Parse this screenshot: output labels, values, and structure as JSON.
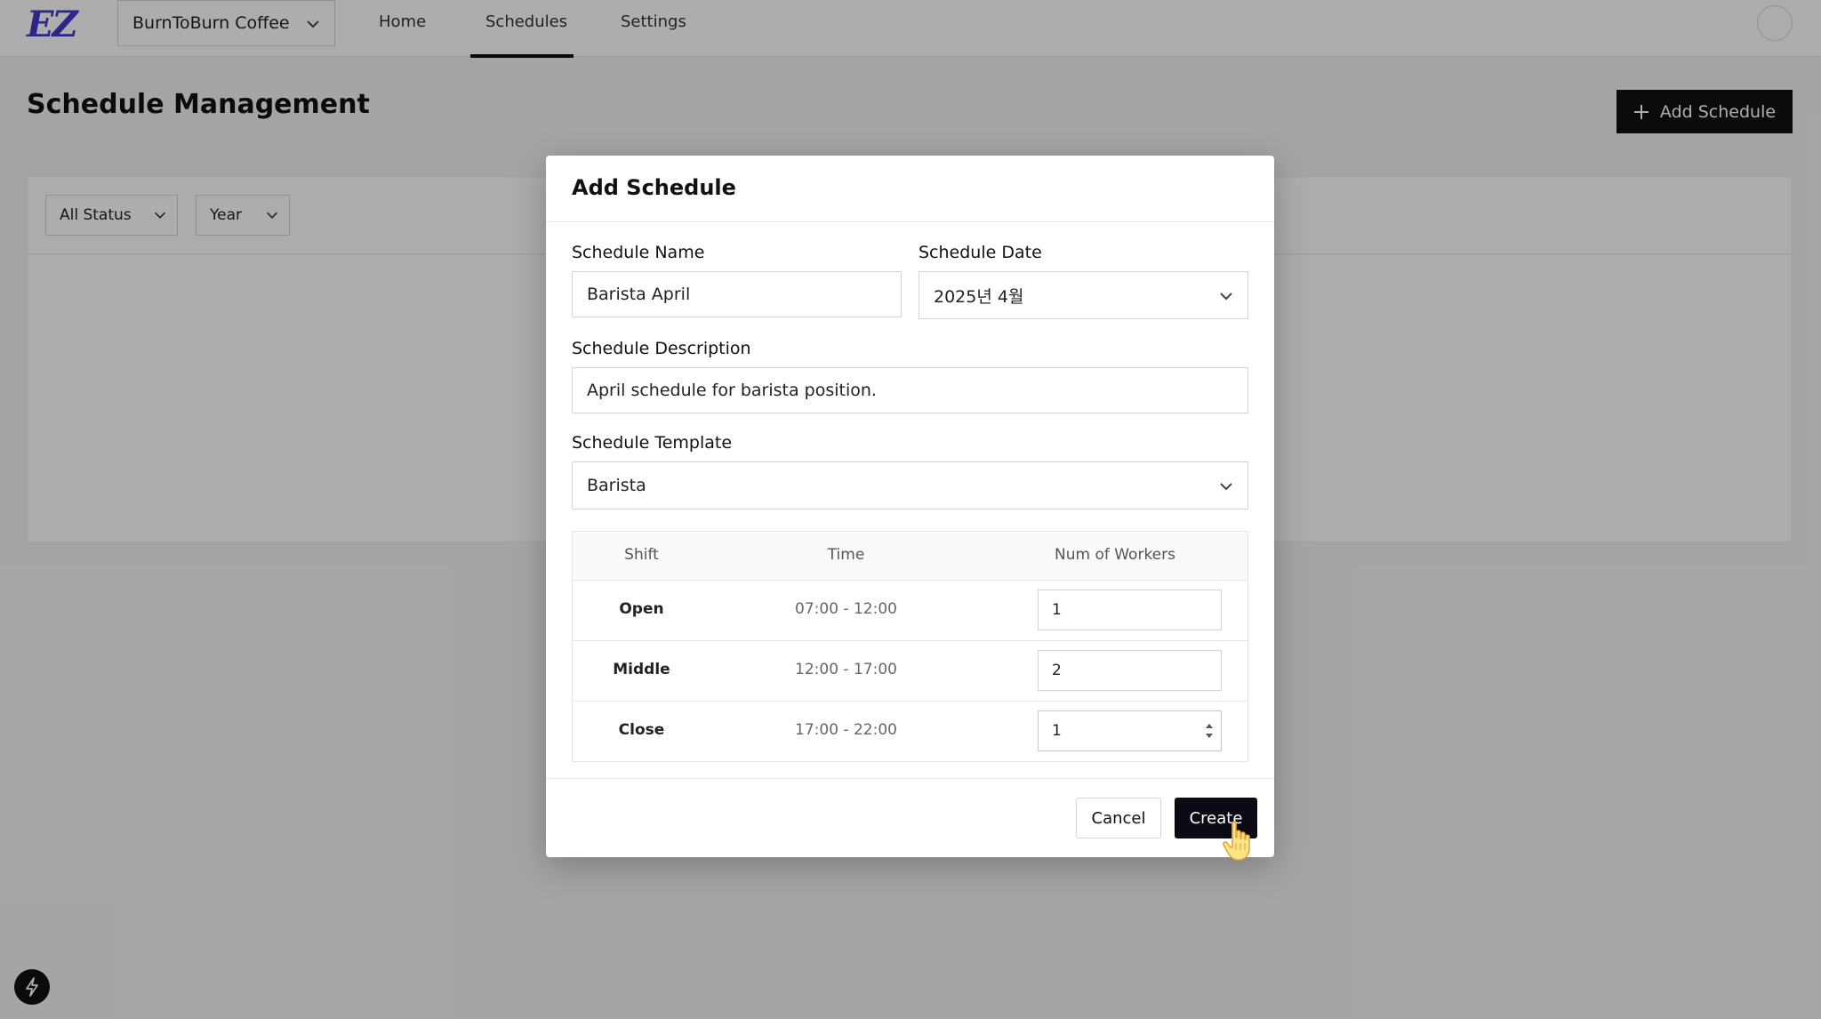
{
  "nav": {
    "logo": "EZ",
    "store": "BurnToBurn Coffee",
    "links": {
      "home": "Home",
      "schedules": "Schedules",
      "settings": "Settings"
    },
    "active_link": "Schedules"
  },
  "page": {
    "title": "Schedule Management",
    "add_button": "Add Schedule",
    "filters": {
      "status": "All Status",
      "year": "Year"
    }
  },
  "modal": {
    "title": "Add Schedule",
    "name_label": "Schedule Name",
    "name_value": "Barista April",
    "date_label": "Schedule Date",
    "date_value": "2025년 4월",
    "description_label": "Schedule Description",
    "description_value": "April schedule for barista position.",
    "template_label": "Schedule Template",
    "template_value": "Barista",
    "table": {
      "headers": {
        "shift": "Shift",
        "time": "Time",
        "workers": "Num of Workers"
      },
      "rows": [
        {
          "shift": "Open",
          "time": "07:00 - 12:00",
          "workers": "1"
        },
        {
          "shift": "Middle",
          "time": "12:00 - 17:00",
          "workers": "2"
        },
        {
          "shift": "Close",
          "time": "17:00 - 22:00",
          "workers": "1"
        }
      ]
    },
    "cancel_label": "Cancel",
    "create_label": "Create"
  },
  "colors": {
    "brand": "#4338ca",
    "primary_button": "#0b0b14",
    "overlay": "rgba(0,0,0,0.32)"
  },
  "icons": {
    "chevron": "chevron-down-icon",
    "plus": "plus-icon",
    "flash": "lightning-icon",
    "cursor": "hand-pointer-icon"
  }
}
